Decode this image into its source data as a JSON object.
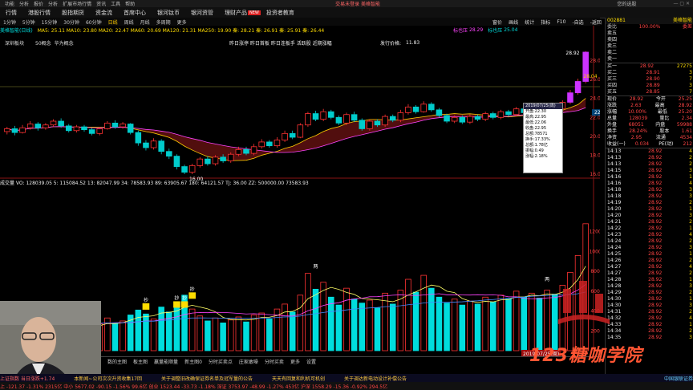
{
  "topbar": {
    "items": [
      "功能",
      "分析",
      "报价",
      "分析",
      "扩展市场行情",
      "资讯",
      "工具",
      "帮助"
    ],
    "center": "交易未登录  美格智能",
    "right": "您的选股"
  },
  "nav": {
    "tabs": [
      "行情",
      "港股行情",
      "股指期货",
      "资金流",
      "首席中心",
      "银河钛币",
      "银河资管",
      "理财产品",
      "投资者教育"
    ],
    "active_index": 0,
    "new_badge": "NEW"
  },
  "period": {
    "items": [
      "1分钟",
      "5分钟",
      "15分钟",
      "30分钟",
      "60分钟",
      "日线",
      "周线",
      "月线",
      "多周期",
      "更多"
    ],
    "active_index": 5
  },
  "rightmenu": {
    "items": [
      "窗价",
      "画线",
      "统计",
      "指标",
      "F10",
      "-自选",
      "-返回"
    ]
  },
  "indicators": {
    "ma_line": "MA5: 25.11  MA10: 23.80  MA20: 22.47  MA60: 20.69  MA120: 21.31  MA250: 19.90  秦: 28.21  秦: 26.91  秦: 25.91  秦: 26.44",
    "stock_tag": "美格智能(日线)",
    "name_tags": [
      "深圳板块",
      "50概念",
      "华为概念"
    ],
    "news_text": "昨日涨停 昨日首板 昨日连板手 活跃股 近期涨幅",
    "issue_price": "发行价格:",
    "issue_value": "11.83",
    "buy_label": "标也压",
    "buy_value": "28.29",
    "zero_label": "标也压",
    "zero_value": "25.04",
    "low_marker": "16.00",
    "high_marker": "28.92",
    "mid_marker": "28.04"
  },
  "volume_info": "成交量  VO: 128039.05  5: 115084.52  13: 82047.99  34: 78583.93  89: 63905.67  180: 64121.57  TJ: 36.00  ZZ: 500000.00  73583.93",
  "tooltip": {
    "rows": [
      "2019/07/25(周)",
      "开盘:22.30",
      "最高:22.95",
      "最低:22.06",
      "收盘:22.95",
      "总额:78571",
      "换手:17.33%",
      "总额:1.78亿",
      "振幅:0.49",
      "涨幅:2.18%"
    ]
  },
  "date_label": "2019/07/25(周)",
  "chart_data": {
    "type": "bar",
    "title": "",
    "ylim": [
      16,
      30
    ],
    "price_ticks": [
      "28.00",
      "26.00",
      "24.00",
      "22.00",
      "20.00",
      "18.00",
      "16.00"
    ],
    "price_label": "22.52",
    "volume_ticks": [
      "12000",
      "10000",
      "8000",
      "6000",
      "4000",
      "2000"
    ],
    "markers": [
      "抄",
      "抄",
      "抄",
      "抄",
      "两",
      "两"
    ],
    "candles": [
      {
        "o": 20.5,
        "c": 20.8,
        "h": 21.0,
        "l": 20.2
      },
      {
        "o": 20.8,
        "c": 20.4,
        "h": 21.1,
        "l": 20.1
      },
      {
        "o": 20.4,
        "c": 20.9,
        "h": 21.2,
        "l": 20.3
      },
      {
        "o": 20.9,
        "c": 21.3,
        "h": 21.6,
        "l": 20.7
      },
      {
        "o": 21.3,
        "c": 20.9,
        "h": 21.5,
        "l": 20.6
      },
      {
        "o": 20.9,
        "c": 21.2,
        "h": 21.4,
        "l": 20.7
      },
      {
        "o": 21.2,
        "c": 21.6,
        "h": 21.8,
        "l": 21.0
      },
      {
        "o": 21.6,
        "c": 21.1,
        "h": 21.9,
        "l": 20.9
      },
      {
        "o": 21.1,
        "c": 20.6,
        "h": 21.3,
        "l": 20.4
      },
      {
        "o": 20.6,
        "c": 21.0,
        "h": 21.2,
        "l": 20.4
      },
      {
        "o": 21.0,
        "c": 20.7,
        "h": 21.2,
        "l": 20.5
      },
      {
        "o": 20.7,
        "c": 20.3,
        "h": 20.9,
        "l": 20.1
      },
      {
        "o": 20.3,
        "c": 20.8,
        "h": 21.0,
        "l": 20.1
      },
      {
        "o": 20.8,
        "c": 21.4,
        "h": 21.6,
        "l": 20.7
      },
      {
        "o": 21.4,
        "c": 21.0,
        "h": 21.7,
        "l": 20.8
      },
      {
        "o": 21.0,
        "c": 21.3,
        "h": 21.5,
        "l": 20.8
      },
      {
        "o": 21.3,
        "c": 20.4,
        "h": 21.4,
        "l": 20.2
      },
      {
        "o": 20.4,
        "c": 19.3,
        "h": 20.6,
        "l": 19.0
      },
      {
        "o": 19.3,
        "c": 18.8,
        "h": 19.6,
        "l": 18.5
      },
      {
        "o": 18.8,
        "c": 19.5,
        "h": 19.8,
        "l": 18.6
      },
      {
        "o": 19.5,
        "c": 18.4,
        "h": 19.7,
        "l": 18.1
      },
      {
        "o": 18.4,
        "c": 17.9,
        "h": 18.7,
        "l": 17.6
      },
      {
        "o": 17.9,
        "c": 16.8,
        "h": 18.1,
        "l": 16.5
      },
      {
        "o": 16.8,
        "c": 16.2,
        "h": 17.0,
        "l": 16.0
      },
      {
        "o": 16.2,
        "c": 16.9,
        "h": 17.1,
        "l": 16.0
      },
      {
        "o": 16.9,
        "c": 17.6,
        "h": 17.8,
        "l": 16.7
      },
      {
        "o": 17.6,
        "c": 17.1,
        "h": 17.9,
        "l": 16.9
      },
      {
        "o": 17.1,
        "c": 17.8,
        "h": 18.0,
        "l": 16.9
      },
      {
        "o": 17.8,
        "c": 17.4,
        "h": 18.1,
        "l": 17.2
      },
      {
        "o": 17.4,
        "c": 18.1,
        "h": 18.3,
        "l": 17.2
      },
      {
        "o": 18.1,
        "c": 18.6,
        "h": 18.9,
        "l": 17.9
      },
      {
        "o": 18.6,
        "c": 18.2,
        "h": 18.9,
        "l": 18.0
      },
      {
        "o": 18.2,
        "c": 18.9,
        "h": 19.2,
        "l": 18.0
      },
      {
        "o": 18.9,
        "c": 19.4,
        "h": 19.7,
        "l": 18.7
      },
      {
        "o": 19.4,
        "c": 19.0,
        "h": 19.6,
        "l": 18.8
      },
      {
        "o": 19.0,
        "c": 19.6,
        "h": 19.9,
        "l": 18.8
      },
      {
        "o": 19.6,
        "c": 20.3,
        "h": 20.6,
        "l": 19.4
      },
      {
        "o": 20.3,
        "c": 19.9,
        "h": 20.6,
        "l": 19.7
      },
      {
        "o": 19.9,
        "c": 21.2,
        "h": 21.4,
        "l": 19.8
      },
      {
        "o": 21.2,
        "c": 22.4,
        "h": 22.6,
        "l": 21.0
      },
      {
        "o": 22.4,
        "c": 21.8,
        "h": 22.7,
        "l": 21.6
      },
      {
        "o": 21.8,
        "c": 22.6,
        "h": 22.9,
        "l": 21.6
      },
      {
        "o": 22.6,
        "c": 22.0,
        "h": 22.8,
        "l": 21.8
      },
      {
        "o": 22.0,
        "c": 21.4,
        "h": 22.2,
        "l": 21.2
      },
      {
        "o": 21.4,
        "c": 22.3,
        "h": 22.5,
        "l": 21.2
      },
      {
        "o": 22.3,
        "c": 21.7,
        "h": 22.6,
        "l": 21.5
      },
      {
        "o": 21.7,
        "c": 20.8,
        "h": 21.9,
        "l": 20.6
      },
      {
        "o": 20.8,
        "c": 21.6,
        "h": 21.8,
        "l": 20.6
      },
      {
        "o": 21.6,
        "c": 21.2,
        "h": 21.8,
        "l": 21.0
      },
      {
        "o": 21.2,
        "c": 22.1,
        "h": 22.3,
        "l": 21.0
      },
      {
        "o": 22.1,
        "c": 21.7,
        "h": 22.3,
        "l": 21.5
      },
      {
        "o": 21.7,
        "c": 22.5,
        "h": 22.8,
        "l": 21.5
      },
      {
        "o": 22.5,
        "c": 23.1,
        "h": 23.4,
        "l": 22.3
      },
      {
        "o": 23.1,
        "c": 22.6,
        "h": 23.3,
        "l": 22.4
      },
      {
        "o": 22.6,
        "c": 23.4,
        "h": 23.7,
        "l": 22.5
      },
      {
        "o": 23.4,
        "c": 22.8,
        "h": 23.6,
        "l": 22.6
      },
      {
        "o": 22.8,
        "c": 22.2,
        "h": 23.0,
        "l": 22.0
      },
      {
        "o": 22.2,
        "c": 21.6,
        "h": 22.4,
        "l": 21.4
      },
      {
        "o": 21.6,
        "c": 22.0,
        "h": 22.2,
        "l": 21.4
      },
      {
        "o": 22.0,
        "c": 21.5,
        "h": 22.2,
        "l": 21.3
      },
      {
        "o": 21.5,
        "c": 22.1,
        "h": 22.3,
        "l": 21.3
      },
      {
        "o": 22.1,
        "c": 21.8,
        "h": 22.3,
        "l": 21.6
      },
      {
        "o": 21.8,
        "c": 22.4,
        "h": 22.6,
        "l": 21.6
      },
      {
        "o": 22.4,
        "c": 22.0,
        "h": 22.6,
        "l": 21.8
      },
      {
        "o": 22.0,
        "c": 22.6,
        "h": 22.8,
        "l": 21.8
      },
      {
        "o": 22.6,
        "c": 22.3,
        "h": 22.8,
        "l": 22.1
      },
      {
        "o": 22.3,
        "c": 22.9,
        "h": 23.1,
        "l": 22.1
      },
      {
        "o": 22.9,
        "c": 22.5,
        "h": 23.1,
        "l": 22.3
      },
      {
        "o": 22.5,
        "c": 23.0,
        "h": 23.2,
        "l": 22.3
      },
      {
        "o": 23.0,
        "c": 22.7,
        "h": 23.2,
        "l": 22.5
      },
      {
        "o": 22.7,
        "c": 23.2,
        "h": 23.4,
        "l": 22.5
      },
      {
        "o": 23.2,
        "c": 22.9,
        "h": 23.4,
        "l": 22.7
      },
      {
        "o": 22.9,
        "c": 23.6,
        "h": 23.8,
        "l": 22.8
      },
      {
        "o": 23.6,
        "c": 24.6,
        "h": 24.9,
        "l": 23.4
      },
      {
        "o": 24.6,
        "c": 25.8,
        "h": 26.1,
        "l": 24.4
      },
      {
        "o": 25.8,
        "c": 28.9,
        "h": 29.0,
        "l": 25.6
      }
    ],
    "volumes": [
      3000,
      2400,
      2800,
      3500,
      3100,
      2700,
      3200,
      2600,
      2200,
      2900,
      2500,
      2300,
      2700,
      3300,
      2800,
      3000,
      3600,
      4100,
      3700,
      3200,
      4400,
      3900,
      4800,
      5600,
      4200,
      3500,
      3000,
      3300,
      2800,
      3100,
      3400,
      2900,
      3600,
      3800,
      3200,
      4200,
      4700,
      3900,
      5600,
      7800,
      6200,
      6900,
      5400,
      4600,
      6300,
      5200,
      4800,
      5100,
      4300,
      5800,
      4700,
      6100,
      7200,
      5900,
      7600,
      6300,
      5400,
      4800,
      5200,
      4600,
      5000,
      4700,
      5400,
      4900,
      5600,
      5200,
      6000,
      5400,
      5800,
      5300,
      6100,
      5700,
      6600,
      7900,
      9600,
      12800
    ],
    "volume_ylim": [
      0,
      14000
    ]
  },
  "quote": {
    "code": "002881",
    "name": "美格智能",
    "change_label": "100.00%",
    "buy_sell_header": "委差",
    "orderbook": [
      {
        "label": "卖五",
        "price": "",
        "vol": ""
      },
      {
        "label": "卖四",
        "price": "",
        "vol": ""
      },
      {
        "label": "卖三",
        "price": "",
        "vol": ""
      },
      {
        "label": "卖二",
        "price": "",
        "vol": ""
      },
      {
        "label": "卖一",
        "price": "",
        "vol": ""
      },
      {
        "label": "买一",
        "price": "28.92",
        "vol": "27275"
      },
      {
        "label": "买二",
        "price": "28.91",
        "vol": "3"
      },
      {
        "label": "买三",
        "price": "28.90",
        "vol": "7"
      },
      {
        "label": "买四",
        "price": "28.89",
        "vol": "3"
      },
      {
        "label": "买五",
        "price": "28.85",
        "vol": "7"
      }
    ],
    "stats": [
      {
        "k": "现价",
        "v": "28.92",
        "k2": "今开",
        "v2": "25.25"
      },
      {
        "k": "涨跌",
        "v": "2.63",
        "k2": "最高",
        "v2": "28.92"
      },
      {
        "k": "涨幅",
        "v": "10.00%",
        "k2": "最低",
        "v2": "25.20"
      },
      {
        "k": "总量",
        "v": "128039",
        "k2": "量比",
        "v2": "2.34"
      },
      {
        "k": "外盘",
        "v": "68051",
        "k2": "内盘",
        "v2": "59988"
      },
      {
        "k": "换手",
        "v": "28.24%",
        "k2": "股本",
        "v2": "1.61"
      },
      {
        "k": "净资",
        "v": "2.95",
        "k2": "流通",
        "v2": "4534"
      },
      {
        "k": "收益(一)",
        "v": "0.034",
        "k2": "PE(动)",
        "v2": "212"
      }
    ],
    "ticks": [
      {
        "t": "14:13",
        "p": "28.92",
        "v": "4"
      },
      {
        "t": "14:13",
        "p": "28.92",
        "v": "2"
      },
      {
        "t": "14:13",
        "p": "28.92",
        "v": "2"
      },
      {
        "t": "14:15",
        "p": "28.92",
        "v": "3"
      },
      {
        "t": "14:16",
        "p": "28.92",
        "v": "1"
      },
      {
        "t": "14:16",
        "p": "28.92",
        "v": "4"
      },
      {
        "t": "14:18",
        "p": "28.92",
        "v": "3"
      },
      {
        "t": "14:18",
        "p": "28.92",
        "v": "3"
      },
      {
        "t": "14:19",
        "p": "28.92",
        "v": "2"
      },
      {
        "t": "14:20",
        "p": "28.92",
        "v": "1"
      },
      {
        "t": "14:20",
        "p": "28.92",
        "v": "3"
      },
      {
        "t": "14:21",
        "p": "28.92",
        "v": "2"
      },
      {
        "t": "14:22",
        "p": "28.92",
        "v": "1"
      },
      {
        "t": "14:23",
        "p": "28.92",
        "v": "4"
      },
      {
        "t": "14:24",
        "p": "28.92",
        "v": "2"
      },
      {
        "t": "14:24",
        "p": "28.92",
        "v": "3"
      },
      {
        "t": "14:25",
        "p": "28.92",
        "v": "1"
      },
      {
        "t": "14:26",
        "p": "28.92",
        "v": "2"
      },
      {
        "t": "14:27",
        "p": "28.92",
        "v": "4"
      },
      {
        "t": "14:27",
        "p": "28.92",
        "v": "2"
      },
      {
        "t": "14:28",
        "p": "28.92",
        "v": "1"
      },
      {
        "t": "14:28",
        "p": "28.92",
        "v": "3"
      },
      {
        "t": "14:29",
        "p": "28.92",
        "v": "2"
      },
      {
        "t": "14:30",
        "p": "28.92",
        "v": "1"
      },
      {
        "t": "14:30",
        "p": "28.92",
        "v": "3"
      },
      {
        "t": "14:31",
        "p": "28.92",
        "v": "2"
      },
      {
        "t": "14:32",
        "p": "28.92",
        "v": "4"
      },
      {
        "t": "14:33",
        "p": "28.92",
        "v": "1"
      },
      {
        "t": "14:34",
        "p": "28.92",
        "v": "2"
      },
      {
        "t": "14:35",
        "p": "28.92",
        "v": "3"
      }
    ]
  },
  "tabs": {
    "items": [
      "盘",
      "数的主图",
      "板主图",
      "赢量能顺量",
      "新主图0",
      "分时买卖点",
      "庄家敢噪",
      "分时买卖",
      "更多",
      "设置"
    ]
  },
  "news": {
    "items": [
      "上证指数  当日涨跌+1.74",
      "本新闻~公司次次升资收集17回",
      "关于调整旧改确保证券名单及冠军量的公告",
      "天天有回复和利机可机创",
      "关于调达新电动设计补偿公告"
    ],
    "right": "中国银联证券"
  },
  "status": {
    "text": "上 -121.37  -1.31%  2315亿   中小 5677.02  -90.15  -1.56%  99.6亿   创业 1523.44  -33.73  -1.18%   深证 3753.97  -48.99  -1.27%  453亿   沪深 1558.29  -15.36  -0.92%  294.5亿"
  },
  "watermark": {
    "text": "123糖咖学院"
  }
}
